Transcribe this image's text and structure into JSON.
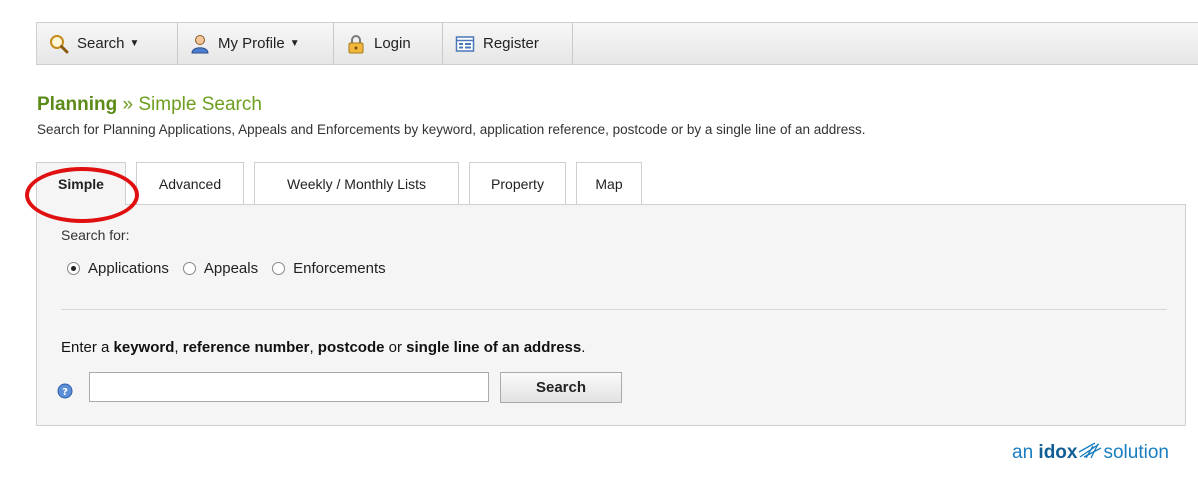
{
  "nav": {
    "items": [
      {
        "label": "Search",
        "icon": "magnifier-icon",
        "dropdown": true
      },
      {
        "label": "My Profile",
        "icon": "user-icon",
        "dropdown": true
      },
      {
        "label": "Login",
        "icon": "lock-icon",
        "dropdown": false
      },
      {
        "label": "Register",
        "icon": "form-icon",
        "dropdown": false
      }
    ]
  },
  "page": {
    "title_section": "Planning",
    "title_separator": "»",
    "title_page": "Simple Search",
    "subtitle": "Search for Planning Applications, Appeals and Enforcements by keyword, application reference, postcode or by a single line of an address."
  },
  "tabs": [
    {
      "label": "Simple",
      "active": true
    },
    {
      "label": "Advanced",
      "active": false
    },
    {
      "label": "Weekly / Monthly Lists",
      "active": false
    },
    {
      "label": "Property",
      "active": false
    },
    {
      "label": "Map",
      "active": false
    }
  ],
  "form": {
    "search_for_label": "Search for:",
    "radios": [
      {
        "label": "Applications",
        "checked": true
      },
      {
        "label": "Appeals",
        "checked": false
      },
      {
        "label": "Enforcements",
        "checked": false
      }
    ],
    "instruction": {
      "p1": "Enter a ",
      "kw1": "keyword",
      "p2": ", ",
      "kw2": "reference number",
      "p3": ", ",
      "kw3": "postcode",
      "p4": " or ",
      "kw4": "single line of an address",
      "p5": "."
    },
    "search_value": "",
    "search_button": "Search"
  },
  "footer": {
    "logo_prefix": "an ",
    "logo_brand": "idox",
    "logo_suffix": "solution"
  },
  "colors": {
    "title_green": "#6e9e1f",
    "annotation_red": "#e01010",
    "logo_blue": "#1a7dbf"
  }
}
